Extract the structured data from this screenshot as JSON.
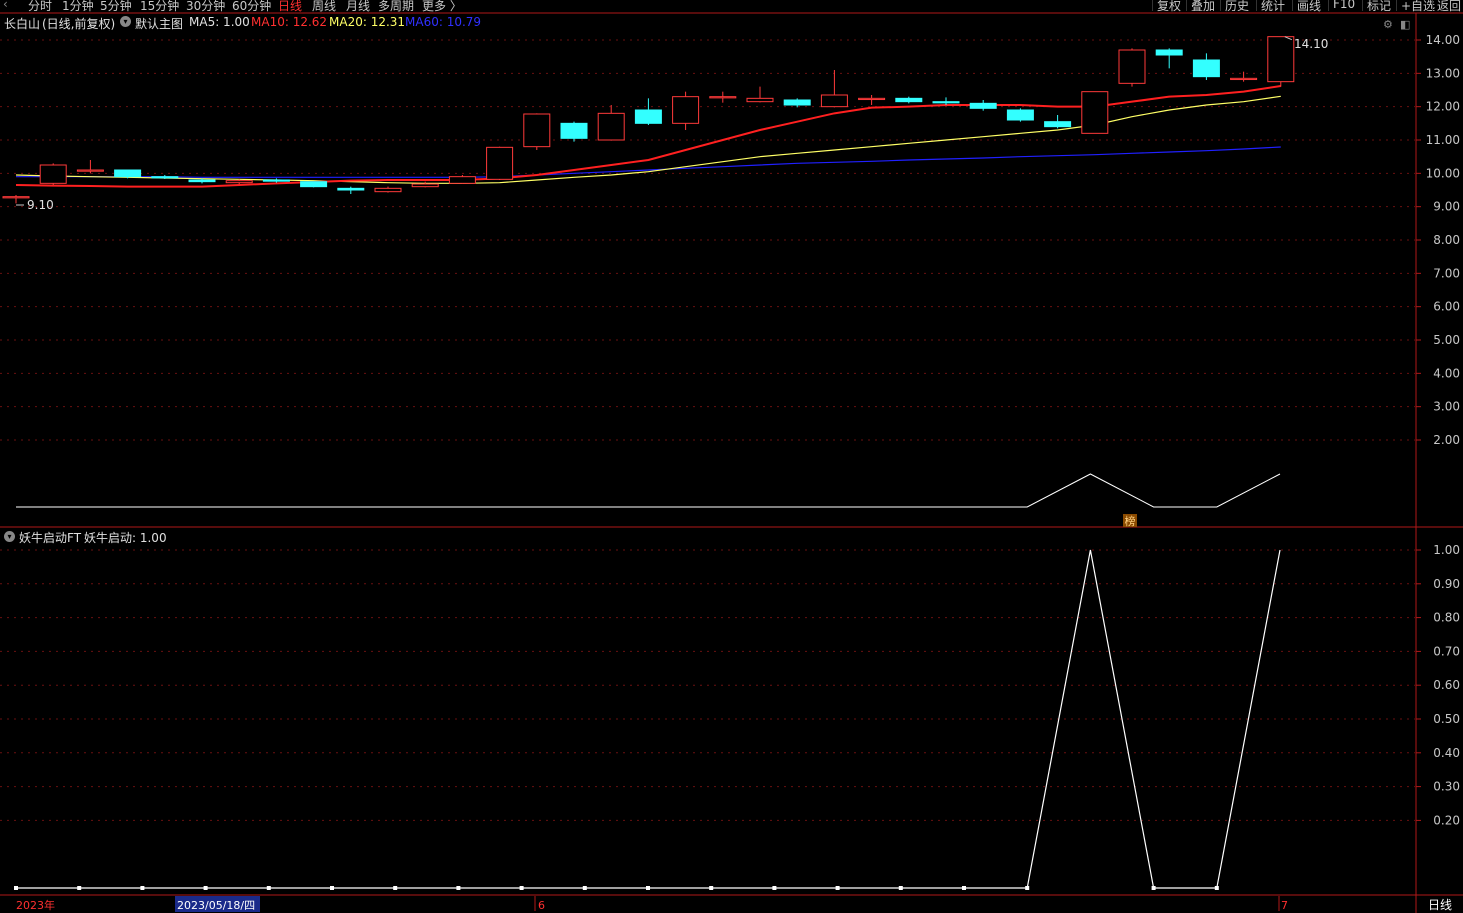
{
  "periods": [
    {
      "label": "分时",
      "active": false
    },
    {
      "label": "1分钟",
      "active": false
    },
    {
      "label": "5分钟",
      "active": false
    },
    {
      "label": "15分钟",
      "active": false
    },
    {
      "label": "30分钟",
      "active": false
    },
    {
      "label": "60分钟",
      "active": false
    },
    {
      "label": "日线",
      "active": true
    },
    {
      "label": "周线",
      "active": false
    },
    {
      "label": "月线",
      "active": false
    },
    {
      "label": "多周期",
      "active": false
    },
    {
      "label": "更多 〉",
      "active": false
    }
  ],
  "tools": [
    "复权",
    "叠加",
    "历史",
    "统计",
    "画线",
    "F10",
    "标记",
    "+自选",
    "返回"
  ],
  "main_panel": {
    "stock": "长白山",
    "mode": "(日线,前复权)",
    "indicator": "默认主图",
    "ma5": "MA5: 1.00",
    "ma10": "MA10: 12.62",
    "ma20": "MA20: 12.31",
    "ma60": "MA60: 10.79",
    "high_marker": "14.10",
    "low_marker": "9.10",
    "signal_label": "榜"
  },
  "sub_panel": {
    "indicator": "妖牛启动FT",
    "value": "妖牛启动: 1.00"
  },
  "footer": {
    "year": "2023年",
    "cursor_date": "2023/05/18/四",
    "month_6": "6",
    "month_7": "7",
    "period_label": "日线"
  },
  "colors": {
    "up": "#ff3a3a",
    "down": "#33ffff",
    "ma10": "#ff2020",
    "ma20": "#ffff66",
    "ma60": "#2020ff",
    "axis": "#b01818"
  },
  "chart_data": [
    {
      "type": "candlestick",
      "ylim": [
        1.5,
        14.3
      ],
      "yticks": [
        "14.00",
        "13.00",
        "12.00",
        "11.00",
        "10.00",
        "9.00",
        "8.00",
        "7.00",
        "6.00",
        "5.00",
        "4.00",
        "3.00",
        "2.00"
      ],
      "candles": [
        {
          "o": 9.3,
          "c": 9.3,
          "h": 9.35,
          "l": 9.1
        },
        {
          "o": 9.7,
          "c": 10.25,
          "h": 10.3,
          "l": 9.65
        },
        {
          "o": 10.1,
          "c": 10.1,
          "h": 10.4,
          "l": 10.0
        },
        {
          "o": 10.1,
          "c": 9.9,
          "h": 10.1,
          "l": 9.85
        },
        {
          "o": 9.9,
          "c": 9.88,
          "h": 9.95,
          "l": 9.83
        },
        {
          "o": 9.8,
          "c": 9.75,
          "h": 9.85,
          "l": 9.7
        },
        {
          "o": 9.72,
          "c": 9.78,
          "h": 9.82,
          "l": 9.68
        },
        {
          "o": 9.8,
          "c": 9.78,
          "h": 9.85,
          "l": 9.72
        },
        {
          "o": 9.75,
          "c": 9.6,
          "h": 9.75,
          "l": 9.58
        },
        {
          "o": 9.55,
          "c": 9.5,
          "h": 9.6,
          "l": 9.38
        },
        {
          "o": 9.45,
          "c": 9.55,
          "h": 9.6,
          "l": 9.42
        },
        {
          "o": 9.6,
          "c": 9.68,
          "h": 9.75,
          "l": 9.58
        },
        {
          "o": 9.7,
          "c": 9.9,
          "h": 9.95,
          "l": 9.68
        },
        {
          "o": 9.82,
          "c": 10.78,
          "h": 10.8,
          "l": 9.8
        },
        {
          "o": 10.8,
          "c": 11.78,
          "h": 11.8,
          "l": 10.7
        },
        {
          "o": 11.5,
          "c": 11.05,
          "h": 11.55,
          "l": 10.95
        },
        {
          "o": 11.0,
          "c": 11.8,
          "h": 12.05,
          "l": 10.98
        },
        {
          "o": 11.9,
          "c": 11.5,
          "h": 12.25,
          "l": 11.45
        },
        {
          "o": 11.5,
          "c": 12.3,
          "h": 12.45,
          "l": 11.3
        },
        {
          "o": 12.3,
          "c": 12.3,
          "h": 12.45,
          "l": 12.12
        },
        {
          "o": 12.15,
          "c": 12.25,
          "h": 12.6,
          "l": 12.13
        },
        {
          "o": 12.2,
          "c": 12.05,
          "h": 12.25,
          "l": 11.98
        },
        {
          "o": 12.0,
          "c": 12.35,
          "h": 13.1,
          "l": 11.98
        },
        {
          "o": 12.25,
          "c": 12.25,
          "h": 12.35,
          "l": 12.05
        },
        {
          "o": 12.25,
          "c": 12.15,
          "h": 12.3,
          "l": 12.1
        },
        {
          "o": 12.15,
          "c": 12.12,
          "h": 12.28,
          "l": 12.05
        },
        {
          "o": 12.1,
          "c": 11.95,
          "h": 12.2,
          "l": 11.88
        },
        {
          "o": 11.9,
          "c": 11.6,
          "h": 11.95,
          "l": 11.55
        },
        {
          "o": 11.55,
          "c": 11.4,
          "h": 11.75,
          "l": 11.35
        },
        {
          "o": 11.2,
          "c": 12.45,
          "h": 12.45,
          "l": 11.2
        },
        {
          "o": 12.7,
          "c": 13.7,
          "h": 13.75,
          "l": 12.6
        },
        {
          "o": 13.7,
          "c": 13.55,
          "h": 13.75,
          "l": 13.15
        },
        {
          "o": 13.4,
          "c": 12.9,
          "h": 13.6,
          "l": 12.8
        },
        {
          "o": 12.85,
          "c": 12.85,
          "h": 13.05,
          "l": 12.75
        },
        {
          "o": 12.75,
          "c": 14.1,
          "h": 14.1,
          "l": 12.6
        }
      ],
      "ma10": [
        9.65,
        9.63,
        9.62,
        9.6,
        9.6,
        9.6,
        9.65,
        9.7,
        9.74,
        9.78,
        9.8,
        9.8,
        9.8,
        9.85,
        9.95,
        10.1,
        10.25,
        10.4,
        10.7,
        11.0,
        11.3,
        11.55,
        11.8,
        11.97,
        12.0,
        12.05,
        12.05,
        12.05,
        12.0,
        12.0,
        12.15,
        12.3,
        12.35,
        12.45,
        12.62
      ],
      "ma20": [
        9.95,
        9.92,
        9.9,
        9.88,
        9.86,
        9.84,
        9.82,
        9.8,
        9.78,
        9.75,
        9.72,
        9.7,
        9.7,
        9.72,
        9.8,
        9.88,
        9.95,
        10.05,
        10.2,
        10.35,
        10.5,
        10.6,
        10.7,
        10.8,
        10.9,
        11.0,
        11.1,
        11.2,
        11.3,
        11.45,
        11.7,
        11.9,
        12.05,
        12.15,
        12.31
      ],
      "ma60": [
        9.9,
        9.9,
        9.9,
        9.9,
        9.9,
        9.88,
        9.88,
        9.88,
        9.88,
        9.88,
        9.88,
        9.88,
        9.88,
        9.9,
        9.95,
        10.0,
        10.05,
        10.1,
        10.15,
        10.2,
        10.25,
        10.3,
        10.33,
        10.36,
        10.4,
        10.43,
        10.46,
        10.5,
        10.53,
        10.56,
        10.6,
        10.64,
        10.68,
        10.73,
        10.79
      ]
    },
    {
      "type": "line",
      "name": "妖牛启动",
      "ylim": [
        0,
        1.05
      ],
      "yticks": [
        "1.00",
        "0.90",
        "0.80",
        "0.70",
        "0.60",
        "0.50",
        "0.40",
        "0.30",
        "0.20"
      ],
      "values": [
        0,
        0,
        0,
        0,
        0,
        0,
        0,
        0,
        0,
        0,
        0,
        0,
        0,
        0,
        0,
        0,
        0,
        1,
        0,
        0,
        1
      ]
    }
  ]
}
